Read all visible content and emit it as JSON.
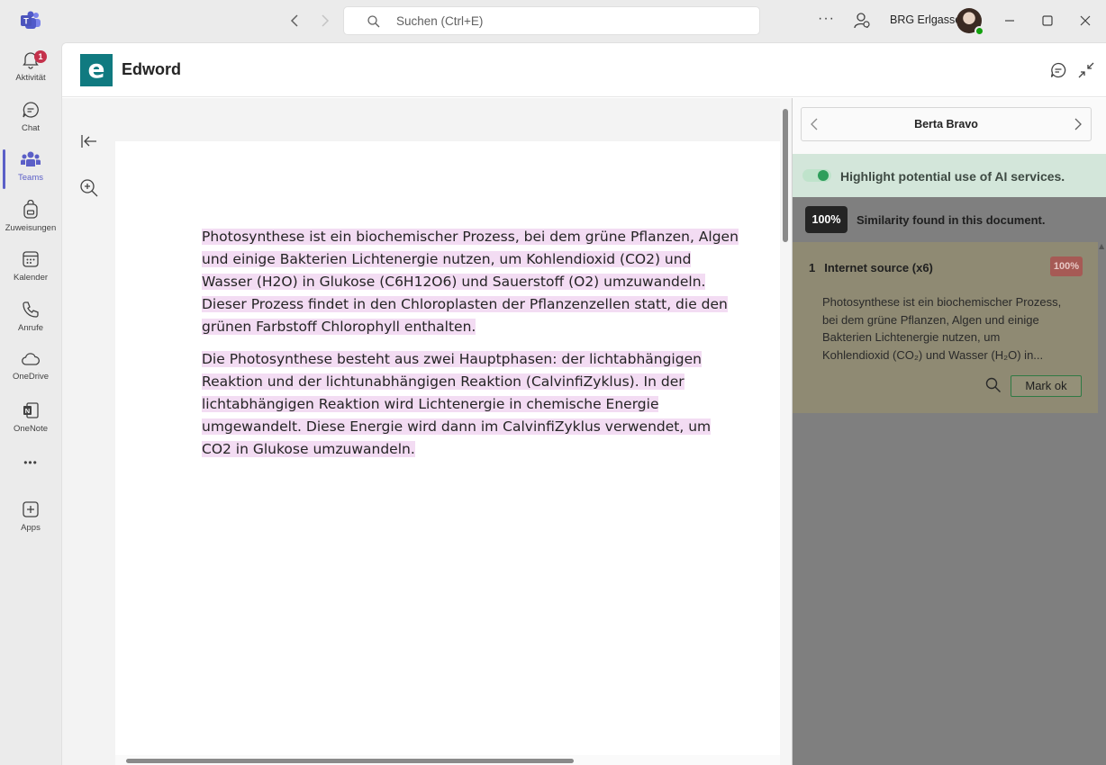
{
  "titlebar": {
    "search_placeholder": "Suchen (Ctrl+E)",
    "org_name": "BRG Erlgasse",
    "back_icon": "chevron-left-icon",
    "forward_icon": "chevron-right-icon"
  },
  "rail": {
    "items": [
      {
        "label": "Aktivität",
        "icon": "bell-icon",
        "badge": "1"
      },
      {
        "label": "Chat",
        "icon": "chat-icon"
      },
      {
        "label": "Teams",
        "icon": "teams-icon",
        "active": true
      },
      {
        "label": "Zuweisungen",
        "icon": "backpack-icon"
      },
      {
        "label": "Kalender",
        "icon": "calendar-icon"
      },
      {
        "label": "Anrufe",
        "icon": "phone-icon"
      },
      {
        "label": "OneDrive",
        "icon": "cloud-icon"
      },
      {
        "label": "OneNote",
        "icon": "onenote-icon"
      },
      {
        "label": "Apps",
        "icon": "add-app-icon"
      }
    ],
    "more": "•••"
  },
  "app": {
    "logo_letter": "e",
    "title": "Edword"
  },
  "document": {
    "paragraphs": [
      "Photosynthese ist ein biochemischer Prozess, bei dem grüne Pﬂanzen, Algen und einige Bakterien Lichtenergie nutzen, um Kohlendioxid (CO2) und Wasser (H2O) in Glukose (C6H12O6) und Sauerstoﬀ (O2) umzuwandeln. Dieser Prozess ﬁndet in den Chloroplasten der Pﬂanzenzellen statt, die den grünen Farbstoﬀ Chlorophyll enthalten.",
      "Die Photosynthese besteht aus zwei Hauptphasen: der lichtabhängigen Reaktion und der lichtunabhängigen Reaktion (CalvinﬁZyklus). In der lichtabhängigen Reaktion wird Lichtenergie in chemische Energie umgewandelt. Diese Energie wird dann im CalvinﬁZyklus verwendet, um CO2 in Glukose umzuwandeln."
    ],
    "highlight_color": "#f3dcf3"
  },
  "panel": {
    "student_name": "Berta Bravo",
    "ai_toggle_label": "Highlight potential use of AI services.",
    "ai_toggle_on": true,
    "similarity_value": "100%",
    "similarity_text": "Similarity found in this document.",
    "sources": [
      {
        "number": "1",
        "title": "Internet source (x6)",
        "percent": "100%",
        "excerpt": "Photosynthese ist ein biochemischer Prozess, bei dem grüne Pflanzen, Algen und einige Bakterien Lichtenergie nutzen, um Kohlendioxid (CO₂) und Wasser (H₂O) in...",
        "mark_ok_label": "Mark ok"
      }
    ]
  },
  "colors": {
    "brand": "#107a80",
    "teams_accent": "#5b5fc7",
    "toggle_green": "#2e9e5b",
    "percent_red": "#a65a55"
  }
}
